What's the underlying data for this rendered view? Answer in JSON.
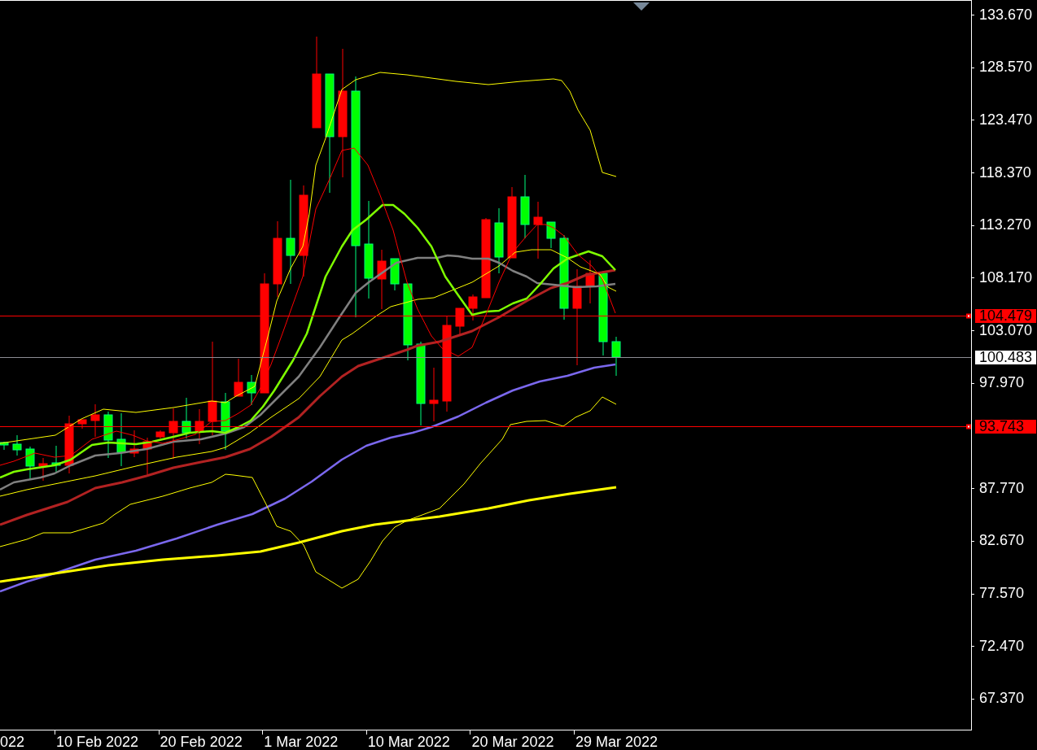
{
  "price_axis": {
    "ticks": [
      "133.670",
      "128.570",
      "123.470",
      "118.370",
      "113.270",
      "108.170",
      "103.070",
      "97.970",
      "87.770",
      "82.670",
      "77.570",
      "72.470",
      "67.370"
    ]
  },
  "price_lines": [
    {
      "kind": "level",
      "label": "104.479",
      "color": "#ff0000"
    },
    {
      "kind": "bid",
      "label": "100.483",
      "color": "#ffffff"
    },
    {
      "kind": "level",
      "label": "93.743",
      "color": "#ff0000"
    }
  ],
  "time_axis": {
    "ticks": [
      "022",
      "10 Feb 2022",
      "20 Feb 2022",
      "1 Mar 2022",
      "10 Mar 2022",
      "20 Mar 2022",
      "29 Mar 2022"
    ]
  }
}
